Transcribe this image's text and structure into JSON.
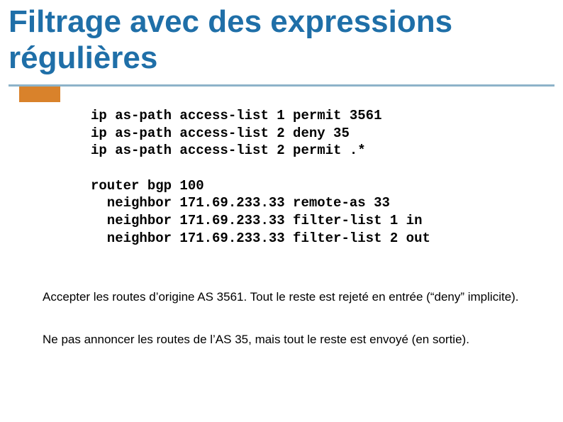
{
  "title_line1": "Filtrage avec des expressions",
  "title_line2": "régulières",
  "code": {
    "l1": "ip as-path access-list 1 permit 3561",
    "l2": "ip as-path access-list 2 deny 35",
    "l3": "ip as-path access-list 2 permit .*",
    "l4": "",
    "l5": "router bgp 100",
    "l6": "  neighbor 171.69.233.33 remote-as 33",
    "l7": "  neighbor 171.69.233.33 filter-list 1 in",
    "l8": "  neighbor 171.69.233.33 filter-list 2 out"
  },
  "para1": "Accepter les routes d’origine AS 3561.  Tout le reste est rejeté en entrée (“deny” implicite).",
  "para2": "Ne pas annoncer les routes de l’AS 35, mais tout le reste est envoyé (en sortie).",
  "chart_data": {
    "type": "table",
    "title": "BGP AS-path filter configuration",
    "access_lists": [
      {
        "list": 1,
        "action": "permit",
        "pattern": "3561"
      },
      {
        "list": 2,
        "action": "deny",
        "pattern": "35"
      },
      {
        "list": 2,
        "action": "permit",
        "pattern": ".*"
      }
    ],
    "router": {
      "asn": 100,
      "neighbors": [
        {
          "ip": "171.69.233.33",
          "remote_as": 33,
          "filter_list_in": 1,
          "filter_list_out": 2
        }
      ]
    }
  }
}
